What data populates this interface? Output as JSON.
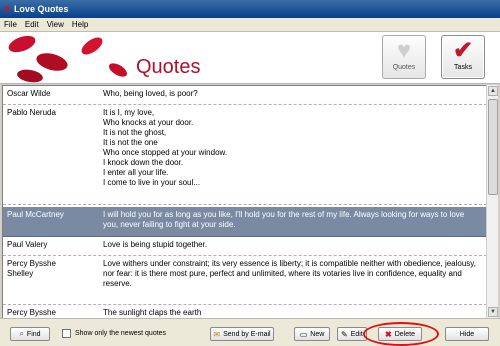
{
  "window": {
    "title": "Love Quotes",
    "icon": "heart-icon"
  },
  "menu": {
    "items": [
      "File",
      "Edit",
      "View",
      "Help"
    ]
  },
  "header": {
    "page_title": "Quotes",
    "quotes_button": "Quotes",
    "tasks_button": "Tasks",
    "accent_color": "#b0102c"
  },
  "quotes": [
    {
      "author": "Oscar Wilde",
      "text": "Who, being loved, is poor?"
    },
    {
      "author": "Pablo Neruda",
      "text": "It is I, my love,\nWho knocks at your door.\nIt is not the ghost,\nIt is not the one\nWho once stopped at your window.\nI knock down the door.\nI enter all your life.\nI come to live in your soul..."
    },
    {
      "author": "Paul McCartney",
      "text": "I will hold you for as long as you like, I'll hold you for the rest of my life. Always looking for ways to love you, never failing to fight at your side."
    },
    {
      "author": "Paul Valery",
      "text": "Love is being stupid together."
    },
    {
      "author": "Percy Bysshe\nShelley",
      "text": "Love withers under constraint; its very essence is liberty; it is compatible neither with obedience, jealousy, nor fear: it is there most pure, perfect and unlimited, where its votaries live in confidence, equality and reserve."
    },
    {
      "author": "Percy Bysshe",
      "text": "The sunlight claps the earth"
    }
  ],
  "toolbar": {
    "find": "Find",
    "show_newest": "Show only the newest quotes",
    "send_email": "Send by E-mail",
    "new": "New",
    "edit": "Edit",
    "delete": "Delete",
    "hide": "Hide"
  }
}
